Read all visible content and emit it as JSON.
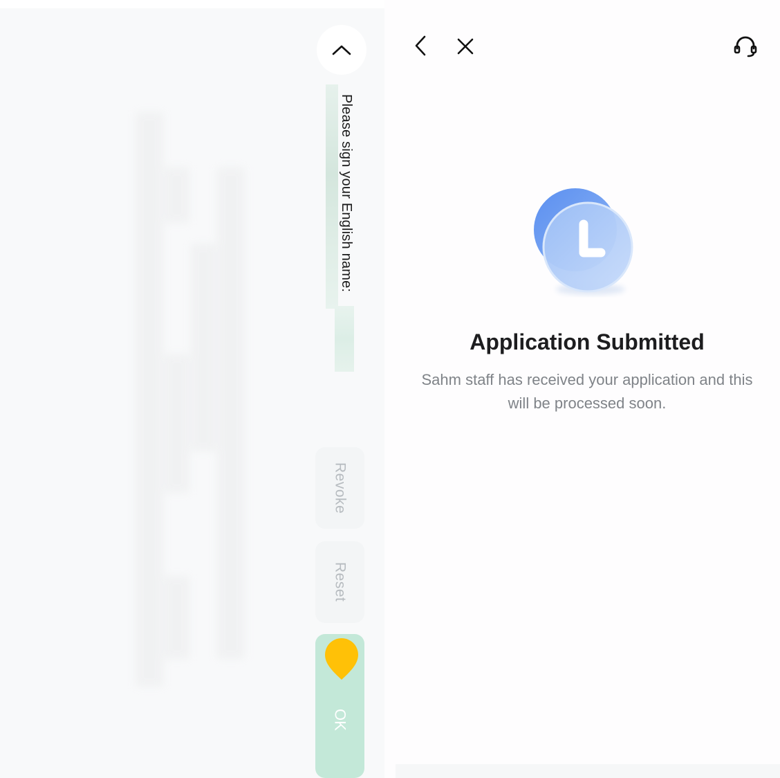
{
  "signature_panel": {
    "prompt": "Please sign your English name:",
    "revoke_label": "Revoke",
    "reset_label": "Reset",
    "ok_label": "OK",
    "collapse_icon": "chevron-up-icon",
    "colors": {
      "ok_button": "#c3e8d8",
      "marker": "#ffc107"
    }
  },
  "status_page": {
    "back_icon": "chevron-left-icon",
    "close_icon": "close-icon",
    "support_icon": "headset-icon",
    "illustration_icon": "clock-icon",
    "title": "Application Submitted",
    "description": "Sahm staff has received your application and this will be processed soon.",
    "colors": {
      "illustration": "#7aa6f0",
      "title": "#1d1d1f",
      "description": "#7f8388"
    }
  }
}
